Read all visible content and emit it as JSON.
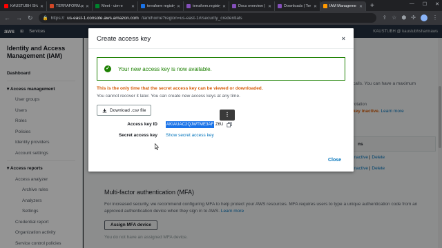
{
  "browser": {
    "tabs": [
      {
        "label": "KAUSTUBH SHA",
        "color": "#ff0000",
        "active": false
      },
      {
        "label": "TERRAFORM.pptx",
        "color": "#d24726",
        "active": false
      },
      {
        "label": "Meet - uim-e",
        "color": "#00832d",
        "active": false
      },
      {
        "label": "terraform registry",
        "color": "#1a73e8",
        "active": false
      },
      {
        "label": "terraform.registry",
        "color": "#844fba",
        "active": false
      },
      {
        "label": "Docs overview | Te",
        "color": "#844fba",
        "active": false
      },
      {
        "label": "Downloads | Ter",
        "color": "#844fba",
        "active": false
      },
      {
        "label": "IAM Manageme",
        "color": "#ff9900",
        "active": true
      }
    ],
    "url_prefix": "https://",
    "url_host": "us-east-1.console.aws.amazon.com",
    "url_path": "/iam/home?region=us-east-1#/security_credentials"
  },
  "aws": {
    "logo": "aws",
    "services": "Services",
    "account": "KAUSTUBH @ kaustubhsharmaws"
  },
  "sidebar": {
    "title": "Identity and Access Management (IAM)",
    "items": [
      {
        "label": "Dashboard",
        "style": "bold"
      },
      {
        "label": "Access management",
        "style": "section"
      },
      {
        "label": "User groups",
        "style": "indent"
      },
      {
        "label": "Users",
        "style": "indent"
      },
      {
        "label": "Roles",
        "style": "indent"
      },
      {
        "label": "Policies",
        "style": "indent"
      },
      {
        "label": "Identity providers",
        "style": "indent"
      },
      {
        "label": "Account settings",
        "style": "indent"
      },
      {
        "label": "Access reports",
        "style": "section"
      },
      {
        "label": "Access analyzer",
        "style": "indent"
      },
      {
        "label": "Archive rules",
        "style": "indent2"
      },
      {
        "label": "Analyzers",
        "style": "indent2"
      },
      {
        "label": "Settings",
        "style": "indent2"
      },
      {
        "label": "Credential report",
        "style": "indent"
      },
      {
        "label": "Organization activity",
        "style": "indent"
      },
      {
        "label": "Service control policies",
        "style": "indent"
      }
    ]
  },
  "background": {
    "right_text": "calls. You can have a maximum",
    "rotation": "rotation",
    "inactive_prefix": "key inactive.",
    "learn_more": "Learn more",
    "panel_text": "ns",
    "row_inactive": "inactive",
    "row_sep": "|",
    "row_delete": "Delete",
    "mfa_title": "Multi-factor authentication (MFA)",
    "mfa_desc": "For increased security, we recommend configuring MFA to help protect your AWS resources. MFA requires users to type a unique authentication code from an approved authentication device when they sign in to AWS.",
    "mfa_learn_more": "Learn more",
    "mfa_button": "Assign MFA device",
    "mfa_none": "You do not have an assigned MFA device."
  },
  "modal": {
    "title": "Create access key",
    "close_x": "×",
    "success_message": "Your new access key is now available.",
    "warning_bold": "This is the only time that the secret access key can be viewed or downloaded.",
    "warning_text": "You cannot recover it later. You can create new access keys at any time.",
    "download_label": "Download .csv file",
    "access_key_label": "Access key ID",
    "access_key_value": "AKIAUAC2QJWTME3AF",
    "access_key_tail": "Z6U",
    "secret_label": "Secret access key",
    "secret_link": "Show secret access key",
    "popup_glyph": "⋮",
    "close_label": "Close"
  }
}
